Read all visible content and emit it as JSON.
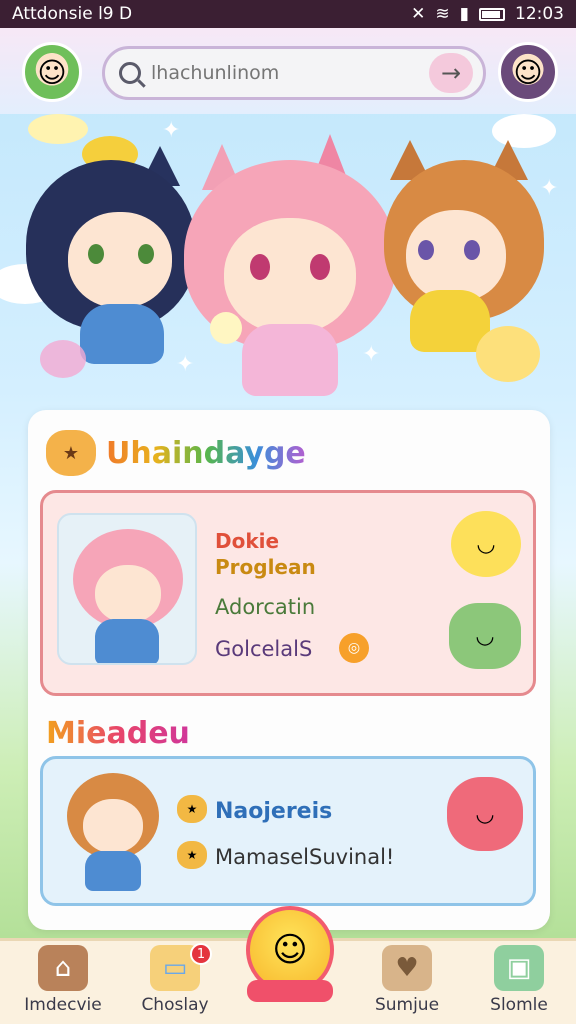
{
  "status_bar": {
    "left_text": "Attdonsie l9  D",
    "time": "12:03"
  },
  "header": {
    "search_placeholder": "lhachunlinom",
    "left_avatar_icon": "profile-avatar-icon",
    "right_avatar_icon": "game-avatar-icon"
  },
  "section1": {
    "title": "Uhaindayge",
    "card": {
      "line1": "Dokie",
      "line2": "Proglean",
      "line3": "Adorcatin",
      "line4": "GolcelalS"
    }
  },
  "section2": {
    "title": "Mieadeu",
    "card": {
      "line1": "Naojereis",
      "line2": "MamaselSuvinal!"
    }
  },
  "bottom_nav": {
    "items": [
      {
        "label": "Imdecvie",
        "icon": "home-icon"
      },
      {
        "label": "Choslay",
        "icon": "cake-icon"
      },
      {
        "label": "Sumjue",
        "icon": "heart-icon"
      },
      {
        "label": "Slomle",
        "icon": "backpack-icon"
      }
    ],
    "center_icon": "smiley-icon",
    "badge_count": "1"
  },
  "colors": {
    "status_bg": "#3b1f33",
    "accent_pink": "#f25b6e",
    "card_pink": "#fde7e5",
    "card_blue": "#e4f2fb"
  }
}
